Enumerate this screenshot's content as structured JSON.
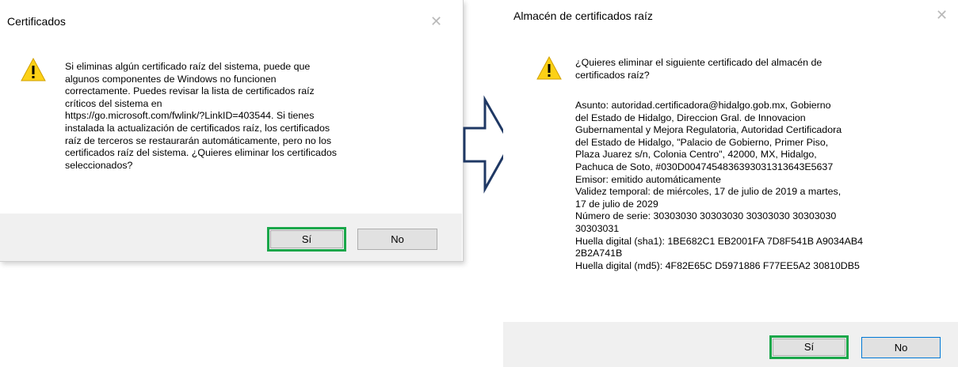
{
  "left_dialog": {
    "title": "Certificados",
    "close_glyph": "✕",
    "message": "Si eliminas algún certificado raíz del sistema, puede que\nalgunos componentes de Windows no funcionen\ncorrectamente. Puedes revisar la lista de certificados raíz\ncríticos del sistema en\nhttps://go.microsoft.com/fwlink/?LinkID=403544. Si tienes\ninstalada la actualización de certificados raíz, los certificados\nraíz de terceros se restaurarán automáticamente, pero no los\ncertificados raíz del sistema. ¿Quieres eliminar los certificados\nseleccionados?",
    "yes_label": "Sí",
    "no_label": "No"
  },
  "right_dialog": {
    "title": "Almacén de certificados raíz",
    "close_glyph": "✕",
    "question": "¿Quieres eliminar el siguiente certificado del almacén de\ncertificados raíz?",
    "details": "Asunto: autoridad.certificadora@hidalgo.gob.mx, Gobierno\ndel Estado de Hidalgo, Direccion Gral. de Innovacion\nGubernamental y Mejora Regulatoria, Autoridad Certificadora\ndel Estado de Hidalgo, \"Palacio de Gobierno, Primer Piso,\nPlaza Juarez s/n, Colonia Centro\", 42000, MX, Hidalgo,\nPachuca de Soto, #030D0047454836393031313643E5637\nEmisor: emitido automáticamente\nValidez temporal: de miércoles, 17 de julio de 2019 a martes,\n17 de julio de 2029\nNúmero de serie: 30303030 30303030 30303030 30303030\n30303031\nHuella digital (sha1): 1BE682C1 EB2001FA 7D8F541B A9034AB4\n2B2A741B\nHuella digital (md5): 4F82E65C D5971886 F77EE5A2 30810DB5",
    "yes_label": "Sí",
    "no_label": "No"
  },
  "colors": {
    "highlight": "#1aa74a",
    "arrow": "#1f3864",
    "warning_fill": "#fcd116"
  },
  "icons": [
    "warning-icon",
    "close-icon",
    "right-arrow-icon"
  ]
}
